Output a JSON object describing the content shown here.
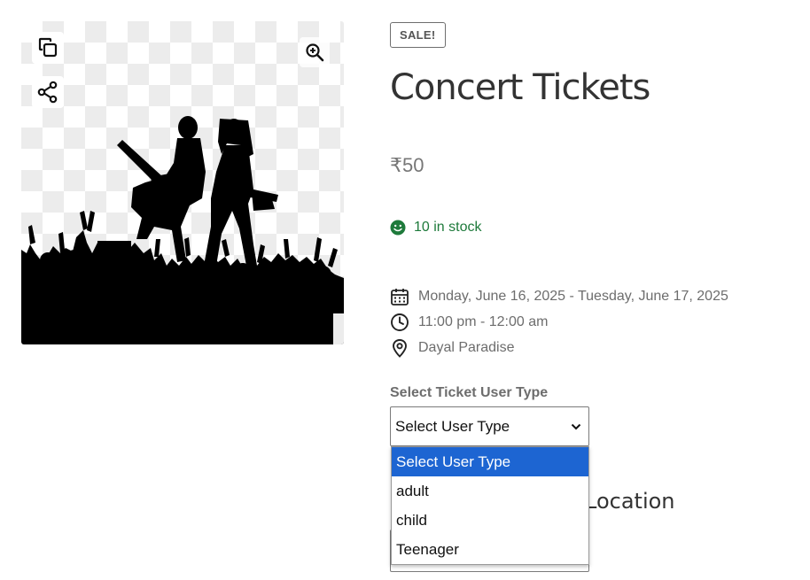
{
  "gallery": {
    "image_alt": "Concert silhouette",
    "copy_icon": "copy-icon",
    "share_icon": "share-icon",
    "zoom_icon": "zoom-in-icon"
  },
  "product": {
    "badge": "SALE!",
    "title": "Concert Tickets",
    "price": "₹50",
    "stock": "10 in stock",
    "stock_color": "#1e7a3b"
  },
  "event": {
    "date": "Monday, June 16, 2025 - Tuesday, June 17, 2025",
    "time": "11:00 pm - 12:00 am",
    "location": "Dayal Paradise"
  },
  "ticket_form": {
    "label": "Select Ticket User Type",
    "selected": "Select User Type",
    "options": [
      "Select User Type",
      "adult",
      "child",
      "Teenager"
    ],
    "highlight_color": "#1d65d2"
  },
  "partially_hidden": {
    "heading_fragment": "Location"
  }
}
